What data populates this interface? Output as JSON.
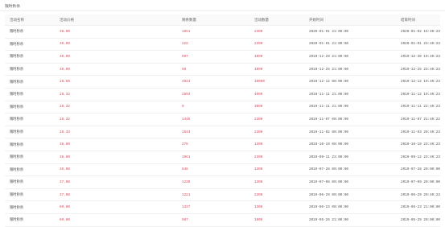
{
  "panel": {
    "title": "限时秒杀"
  },
  "table": {
    "columns": [
      "活动名称",
      "活动价格",
      "剩余数量",
      "活动数量",
      "开始时间",
      "结束时间"
    ],
    "rows": [
      [
        "限时秒杀",
        "38.00",
        "1851",
        "2300",
        "2020-01-01 21:00:00",
        "2020-01-02 15:40:23"
      ],
      [
        "限时秒杀",
        "38.00",
        "222",
        "2300",
        "2020-01-01 21:00:00",
        "2020-01-01 23:40:23"
      ],
      [
        "限时秒杀",
        "38.00",
        "987",
        "1000",
        "2019-12-29 21:00:00",
        "2019-12-30 19:40:23"
      ],
      [
        "限时秒杀",
        "38.00",
        "98",
        "1000",
        "2019-12-25 21:00:00",
        "2019-12-25 23:40:23"
      ],
      [
        "限时秒杀",
        "28.50",
        "4924",
        "10000",
        "2019-12-12 00:00:00",
        "2019-12-12 19:40:23"
      ],
      [
        "限时秒杀",
        "28.32",
        "2893",
        "4000",
        "2019-11-11 21:00:00",
        "2019-11-12 19:40:23"
      ],
      [
        "限时秒杀",
        "28.32",
        "0",
        "3000",
        "2019-11-11 21:00:00",
        "2019-11-11 22:40:23"
      ],
      [
        "限时秒杀",
        "28.32",
        "1445",
        "2300",
        "2019-11-07 00:00:00",
        "2019-11-07 21:40:22"
      ],
      [
        "限时秒杀",
        "28.33",
        "1543",
        "2300",
        "2019-11-02 00:00:00",
        "2019-11-03 20:40:23"
      ],
      [
        "限时秒杀",
        "38.00",
        "278",
        "1300",
        "2019-10-19 00:00:00",
        "2019-10-19 23:40:23"
      ],
      [
        "限时秒杀",
        "38.00",
        "1961",
        "2300",
        "2019-09-11 23:00:00",
        "2019-09-12 23:40:23"
      ],
      [
        "限时秒杀",
        "35.00",
        "848",
        "1300",
        "2019-07-28 00:00:00",
        "2019-07-28 20:00:00"
      ],
      [
        "限时秒杀",
        "37.00",
        "1239",
        "1300",
        "2019-07-08 00:00:00",
        "2019-07-09 20:00:00"
      ],
      [
        "限时秒杀",
        "37.00",
        "1221",
        "2300",
        "2019-06-29 00:00:00",
        "2019-06-29 20:40:23"
      ],
      [
        "限时秒杀",
        "60.00",
        "1337",
        "1300",
        "2019-06-23 00:00:00",
        "2019-06-23 21:00:00"
      ],
      [
        "限时秒杀",
        "60.00",
        "987",
        "1000",
        "2019-05-26 21:00:00",
        "2019-05-29 20:00:00"
      ]
    ]
  }
}
